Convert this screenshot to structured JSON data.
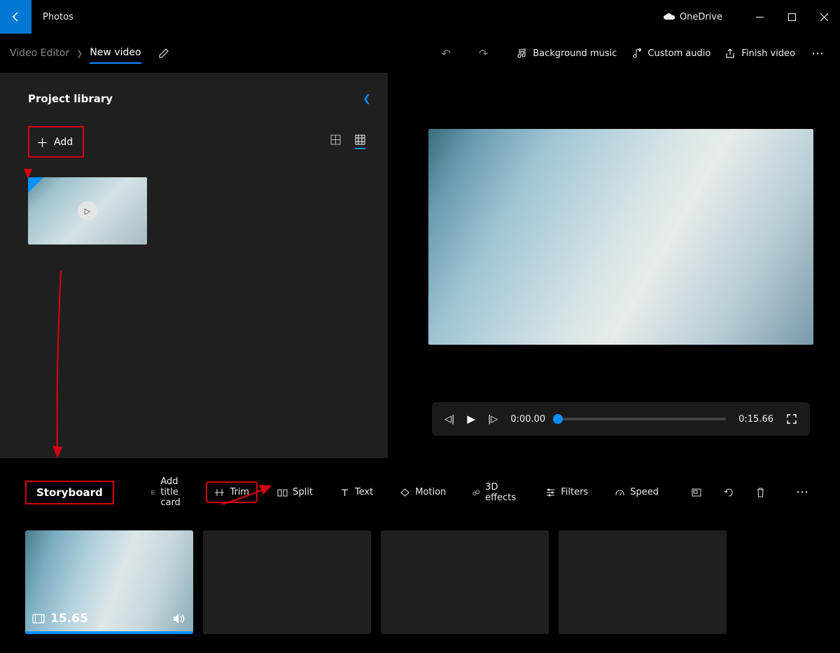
{
  "app_title": "Photos",
  "onedrive_label": "OneDrive",
  "breadcrumb": {
    "root": "Video Editor",
    "project": "New video"
  },
  "toolbar": {
    "background_music": "Background music",
    "custom_audio": "Custom audio",
    "finish_video": "Finish video"
  },
  "library": {
    "title": "Project library",
    "add_label": "Add"
  },
  "player": {
    "current_time": "0:00.00",
    "total_time": "0:15.66"
  },
  "storyboard": {
    "title": "Storyboard",
    "tools": {
      "add_title_card": "Add title card",
      "trim": "Trim",
      "split": "Split",
      "text": "Text",
      "motion": "Motion",
      "effects_3d": "3D effects",
      "filters": "Filters",
      "speed": "Speed"
    },
    "clip_duration": "15.65"
  },
  "annotations": {
    "color": "#d7000f"
  }
}
